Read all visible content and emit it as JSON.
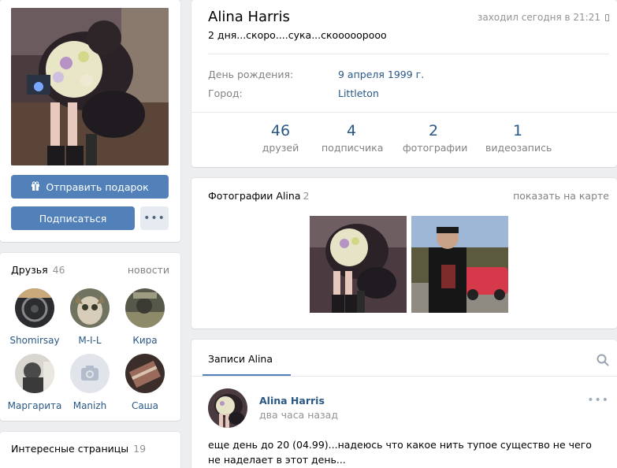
{
  "profile": {
    "name": "Alina Harris",
    "status": "2 дня...скоро....сука...скооооорооо",
    "last_seen": "заходил сегодня в 21:21",
    "birthday_label": "День рождения:",
    "birthday_value": "9 апреля 1999 г.",
    "city_label": "Город:",
    "city_value": "Littleton"
  },
  "counters": [
    {
      "num": "46",
      "label": "друзей"
    },
    {
      "num": "4",
      "label": "подписчика"
    },
    {
      "num": "2",
      "label": "фотографии"
    },
    {
      "num": "1",
      "label": "видеозапись"
    }
  ],
  "actions": {
    "gift_label": "Отправить подарок",
    "subscribe_label": "Подписаться",
    "more_label": "•••"
  },
  "friends_block": {
    "title": "Друзья",
    "count": "46",
    "link": "новости",
    "friends": [
      "Shomirsay",
      "M-I-L",
      "Кира",
      "Маргарита",
      "Manizh",
      "Саша"
    ]
  },
  "interesting_block": {
    "title": "Интересные страницы",
    "count": "19"
  },
  "photos_block": {
    "title": "Фотографии Alina",
    "count": "2",
    "map_link": "показать на карте"
  },
  "wall": {
    "tab_label": "Записи Alina",
    "post": {
      "author": "Alina Harris",
      "time": "два часа назад",
      "text": "еще день до 20 (04.99)...надеюсь что какое нить тупое существо не чего не наделает в этот день..."
    }
  },
  "colors": {
    "page_bg": "#edeef0",
    "accent": "#5181b8",
    "link": "#2a5885"
  }
}
